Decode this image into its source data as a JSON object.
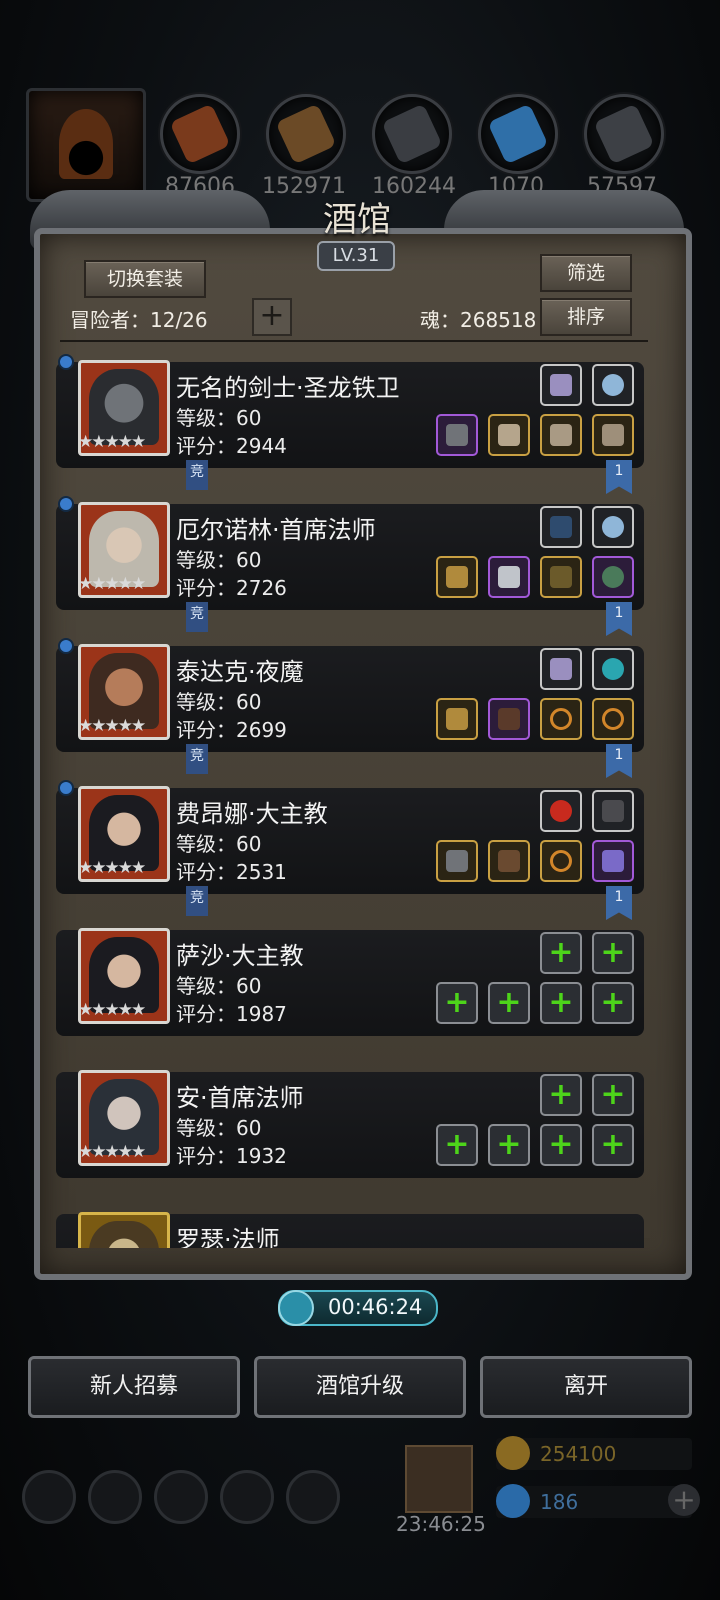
{
  "top_resources": [
    {
      "name": "wood-logs",
      "value": "87606",
      "color": "#7a3a1c"
    },
    {
      "name": "planks",
      "value": "152971",
      "color": "#6b4a26"
    },
    {
      "name": "iron-ingots",
      "value": "160244",
      "color": "#3a3d42"
    },
    {
      "name": "crystals",
      "value": "1070",
      "color": "#2f6fa8"
    },
    {
      "name": "steel",
      "value": "57597",
      "color": "#3d4045"
    }
  ],
  "tavern": {
    "title": "酒馆",
    "level": "LV.31",
    "switch_outfit": "切换套装",
    "filter": "筛选",
    "sort": "排序",
    "adventurers_label": "冒险者：12/26",
    "soul_label": "魂：268518"
  },
  "heroes": [
    {
      "name": "无名的剑士·圣龙铁卫",
      "level": "等级：60",
      "score": "评分：2944",
      "stars": "★★★★★",
      "tag": "竞",
      "ribbon": "1",
      "frame": "red"
    },
    {
      "name": "厄尔诺林·首席法师",
      "level": "等级：60",
      "score": "评分：2726",
      "stars": "★★★★★",
      "tag": "竞",
      "ribbon": "1",
      "frame": "red"
    },
    {
      "name": "泰达克·夜魔",
      "level": "等级：60",
      "score": "评分：2699",
      "stars": "★★★★★",
      "tag": "竞",
      "ribbon": "1",
      "frame": "red"
    },
    {
      "name": "费昂娜·大主教",
      "level": "等级：60",
      "score": "评分：2531",
      "stars": "★★★★★",
      "tag": "竞",
      "ribbon": "1",
      "frame": "red"
    },
    {
      "name": "萨沙·大主教",
      "level": "等级：60",
      "score": "评分：1987",
      "stars": "★★★★★",
      "frame": "red"
    },
    {
      "name": "安·首席法师",
      "level": "等级：60",
      "score": "评分：1932",
      "stars": "★★★★★",
      "frame": "red"
    },
    {
      "name": "罗瑟·法师",
      "frame": "gold"
    }
  ],
  "timer": "00:46:24",
  "actions": {
    "recruit": "新人招募",
    "upgrade": "酒馆升级",
    "leave": "离开"
  },
  "bottom": {
    "gift_timer": "23:46:25",
    "gold": "254100",
    "gems": "186"
  }
}
